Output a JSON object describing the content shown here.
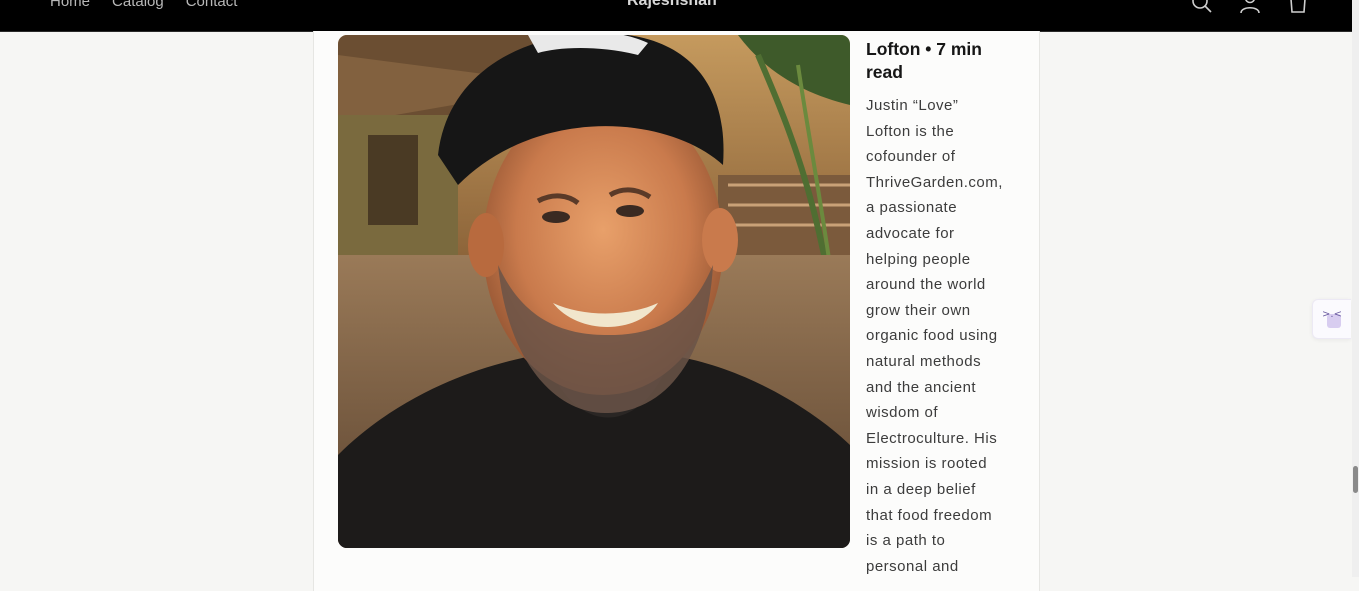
{
  "header": {
    "nav": [
      "Home",
      "Catalog",
      "Contact"
    ],
    "brand": "Rajeshshah",
    "icons": [
      "search-icon",
      "account-icon",
      "cart-icon"
    ]
  },
  "article": {
    "photo_icon": "portrait-photo",
    "title_line1": "Lofton • 7 min",
    "title_line2": "read",
    "paragraph_lines": [
      "Justin “Love”",
      "Lofton is the",
      "cofounder of",
      "ThriveGarden.com,",
      "a passionate",
      "advocate for",
      "helping people",
      "around the world",
      "grow their own",
      "organic food using",
      "natural methods",
      "and the ancient",
      "wisdom of",
      "Electroculture. His",
      "mission is rooted",
      "in a deep belief",
      "that food freedom",
      "is a path to",
      "personal and"
    ]
  },
  "widget": {
    "glyph": ">.<"
  }
}
